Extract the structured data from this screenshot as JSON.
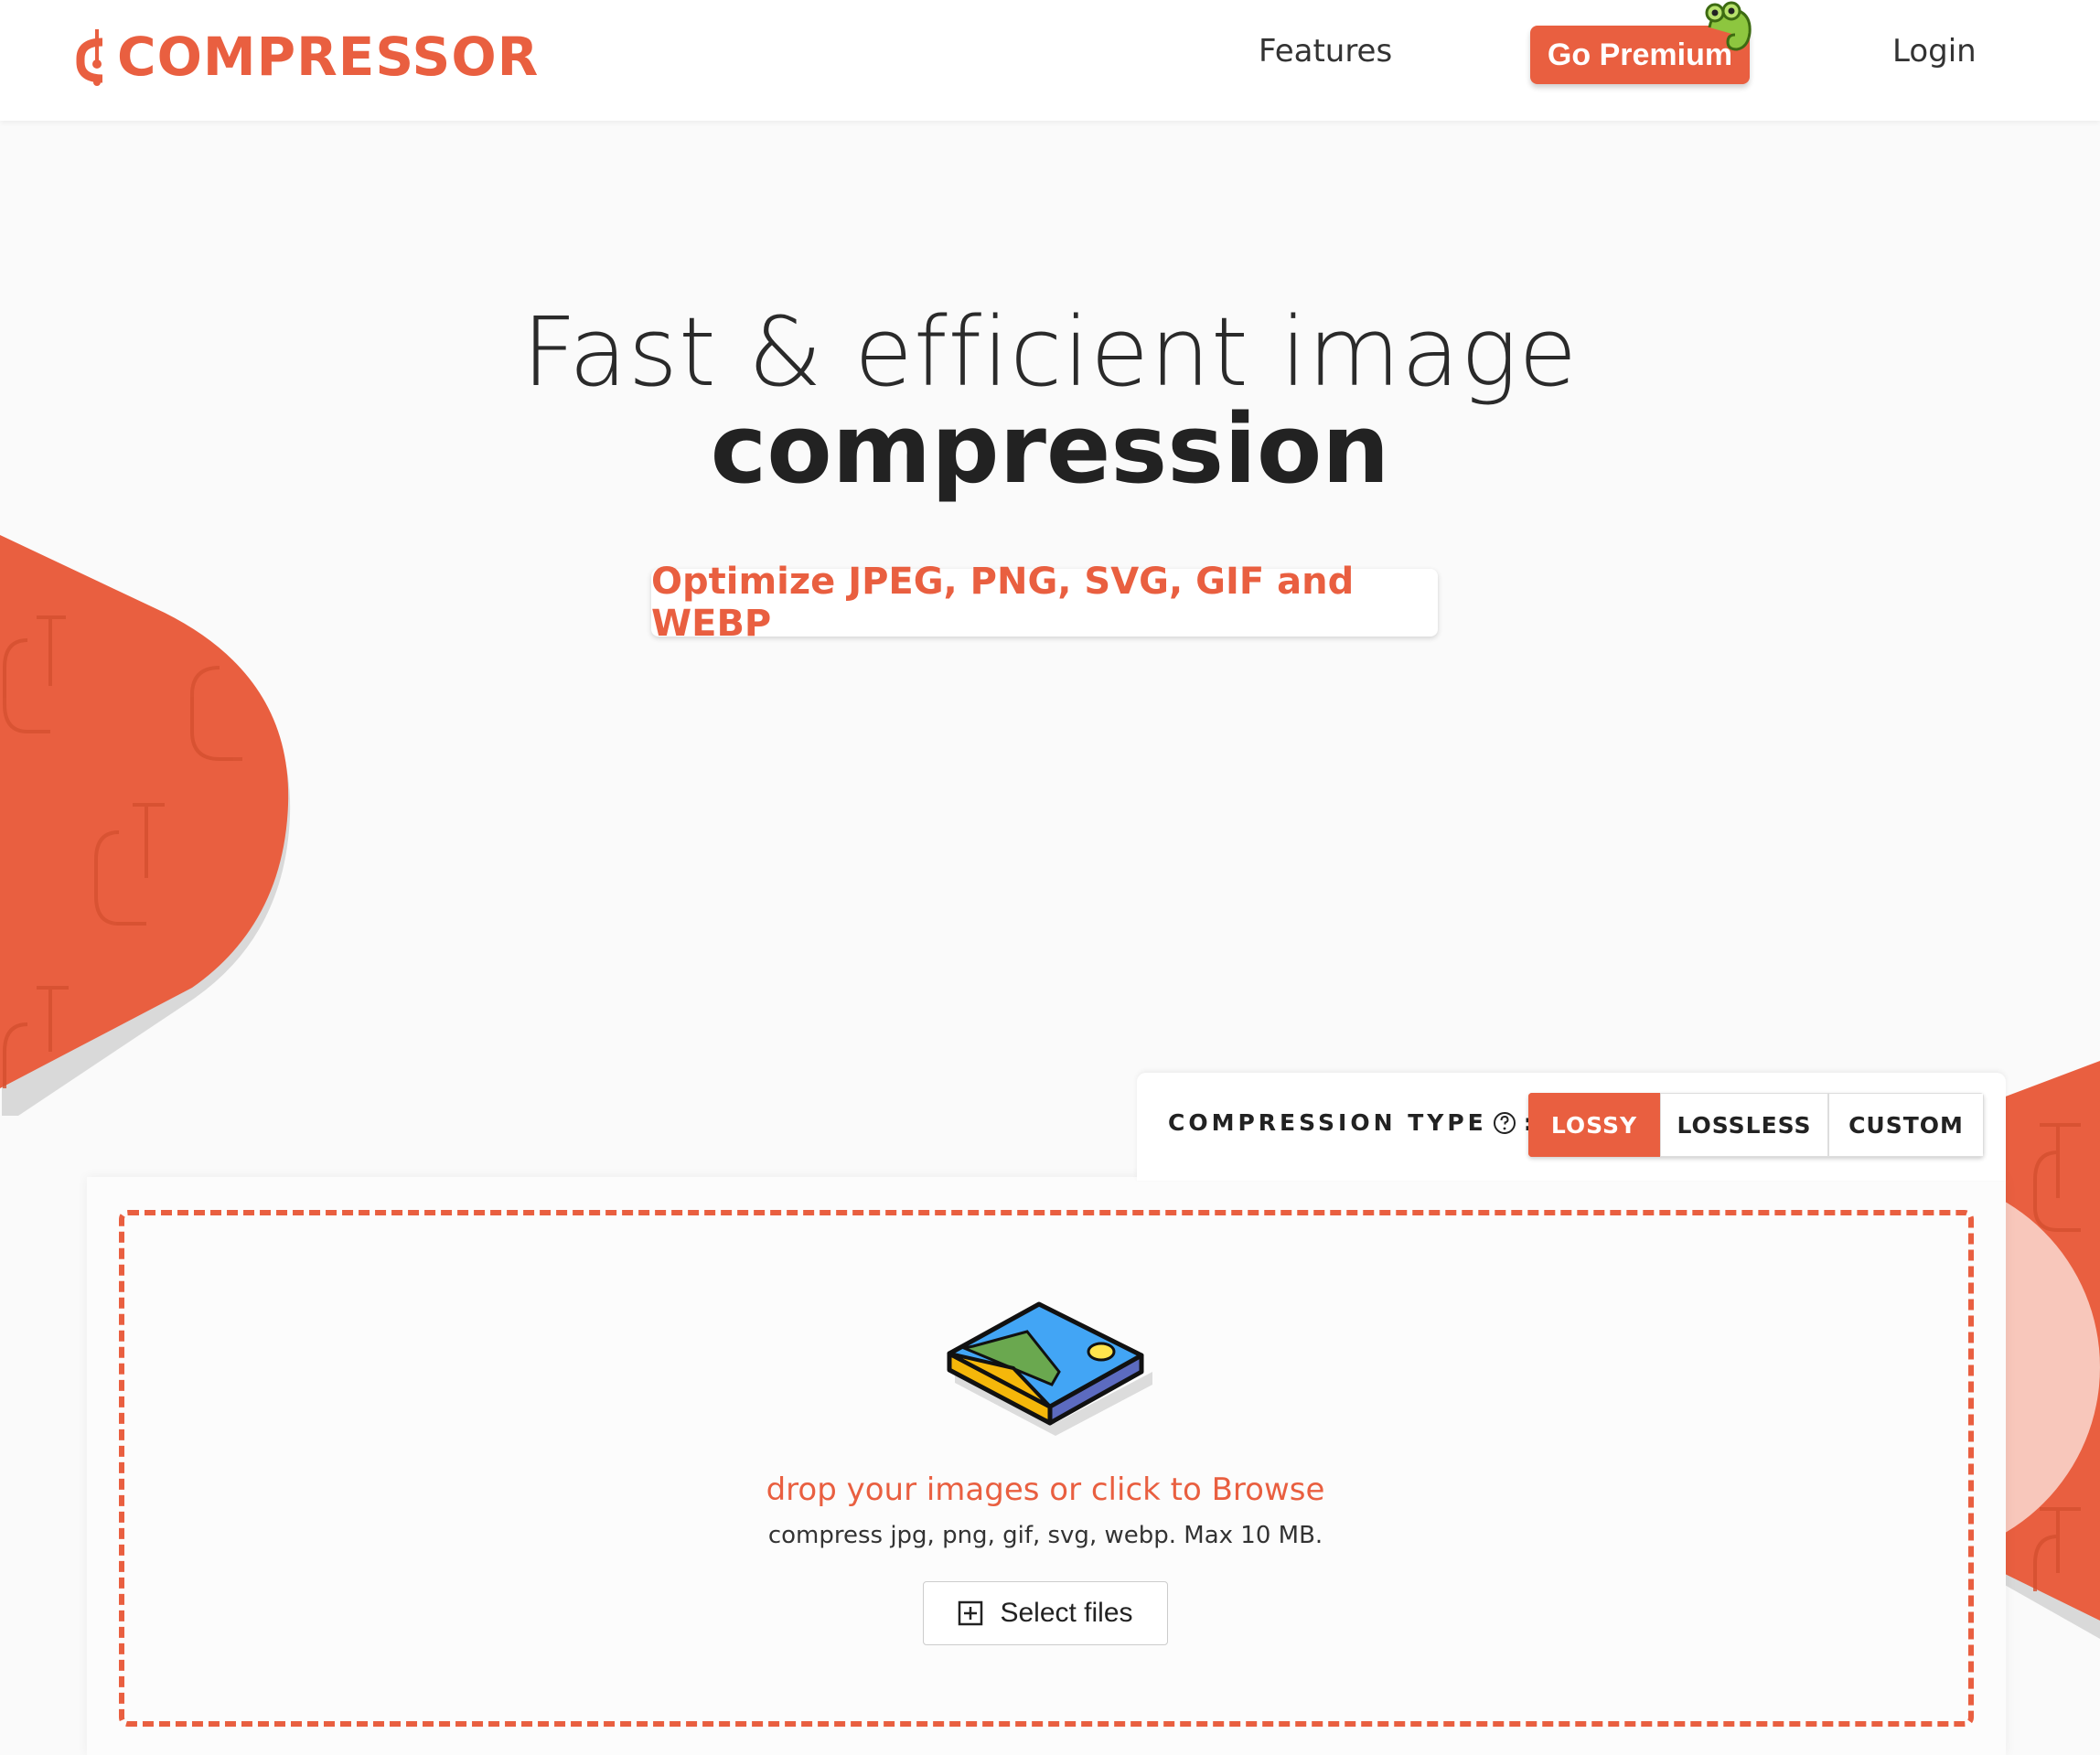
{
  "nav": {
    "logo": "COMPRESSOR",
    "features": "Features",
    "premium": "Go Premium",
    "login": "Login"
  },
  "hero": {
    "line1": "Fast & efficient image",
    "line2": "compression",
    "subtitle": "Optimize JPEG, PNG, SVG, GIF and WEBP"
  },
  "compression": {
    "label": "COMPRESSION TYPE",
    "colon": ":",
    "options": [
      "LOSSY",
      "LOSSLESS",
      "CUSTOM"
    ],
    "selected": "LOSSY"
  },
  "dropzone": {
    "main": "drop your images or click to Browse",
    "sub": "compress jpg, png, gif, svg, webp. Max 10 MB.",
    "select": "Select files"
  },
  "colors": {
    "brand": "#e95f40",
    "background": "#fafafa"
  },
  "icons": [
    "logo-clamp-icon",
    "mascot-chameleon-icon",
    "help-circle-icon",
    "image-stack-icon",
    "plus-square-icon"
  ]
}
